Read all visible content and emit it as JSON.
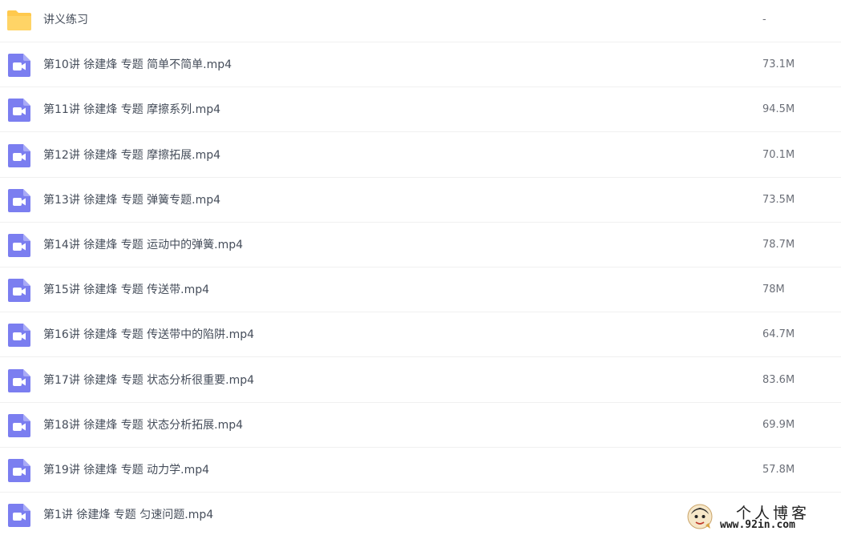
{
  "files": [
    {
      "name": "讲义练习",
      "size": "-",
      "icon": "folder-icon"
    },
    {
      "name": "第10讲 徐建烽 专题 简单不简单.mp4",
      "size": "73.1M",
      "icon": "video-file-icon"
    },
    {
      "name": "第11讲 徐建烽 专题 摩擦系列.mp4",
      "size": "94.5M",
      "icon": "video-file-icon"
    },
    {
      "name": "第12讲 徐建烽 专题 摩擦拓展.mp4",
      "size": "70.1M",
      "icon": "video-file-icon"
    },
    {
      "name": "第13讲 徐建烽 专题 弹簧专题.mp4",
      "size": "73.5M",
      "icon": "video-file-icon"
    },
    {
      "name": "第14讲 徐建烽 专题 运动中的弹簧.mp4",
      "size": "78.7M",
      "icon": "video-file-icon"
    },
    {
      "name": "第15讲 徐建烽 专题 传送带.mp4",
      "size": "78M",
      "icon": "video-file-icon"
    },
    {
      "name": "第16讲 徐建烽 专题 传送带中的陷阱.mp4",
      "size": "64.7M",
      "icon": "video-file-icon"
    },
    {
      "name": "第17讲 徐建烽 专题 状态分析很重要.mp4",
      "size": "83.6M",
      "icon": "video-file-icon"
    },
    {
      "name": "第18讲 徐建烽 专题 状态分析拓展.mp4",
      "size": "69.9M",
      "icon": "video-file-icon"
    },
    {
      "name": "第19讲 徐建烽 专题 动力学.mp4",
      "size": "57.8M",
      "icon": "video-file-icon"
    },
    {
      "name": "第1讲 徐建烽 专题 匀速问题.mp4",
      "size": "",
      "icon": "video-file-icon"
    }
  ],
  "watermark": {
    "title": "个人博客",
    "url": "www.92in.com"
  },
  "colors": {
    "folder": "#ffc94d",
    "video_icon": "#7b7ef0",
    "text": "#454d5a",
    "size_text": "#6b6f78",
    "divider": "#f0f0f0"
  }
}
